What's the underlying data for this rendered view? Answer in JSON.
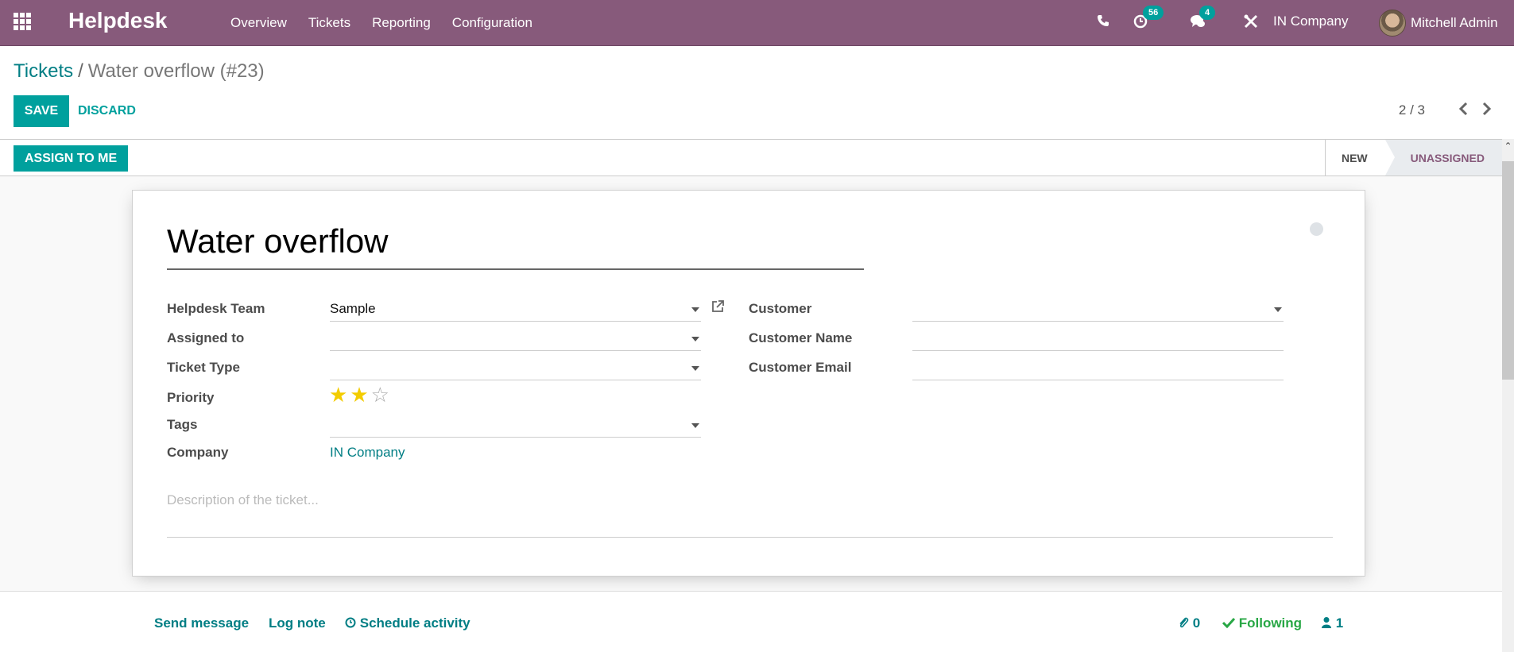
{
  "navbar": {
    "app_name": "Helpdesk",
    "menu": [
      "Overview",
      "Tickets",
      "Reporting",
      "Configuration"
    ],
    "systray": {
      "phone_icon": "phone-icon",
      "activity_badge": "56",
      "messages_badge": "4",
      "debug_icon": "tools-icon",
      "company": "IN Company",
      "user": "Mitchell Admin"
    },
    "bg_color": "#875a7b"
  },
  "breadcrumb": {
    "parent": "Tickets",
    "separator": "/",
    "current": "Water overflow (#23)"
  },
  "toolbar": {
    "save_label": "SAVE",
    "discard_label": "DISCARD",
    "pager": "2 / 3",
    "prev_icon": "‹",
    "next_icon": "›"
  },
  "statusbar": {
    "assign_label": "ASSIGN TO ME",
    "stages": [
      {
        "label": "NEW",
        "active": false
      },
      {
        "label": "UNASSIGNED",
        "active": true
      }
    ]
  },
  "form": {
    "title": "Water overflow",
    "left_fields": {
      "helpdesk_team": {
        "label": "Helpdesk Team",
        "value": "Sample"
      },
      "assigned_to": {
        "label": "Assigned to",
        "value": ""
      },
      "ticket_type": {
        "label": "Ticket Type",
        "value": ""
      },
      "priority": {
        "label": "Priority",
        "value": 2,
        "max": 3
      },
      "tags": {
        "label": "Tags",
        "value": ""
      },
      "company": {
        "label": "Company",
        "value": "IN Company"
      }
    },
    "right_fields": {
      "customer": {
        "label": "Customer",
        "value": ""
      },
      "customer_name": {
        "label": "Customer Name",
        "value": ""
      },
      "customer_email": {
        "label": "Customer Email",
        "value": ""
      }
    },
    "description_placeholder": "Description of the ticket..."
  },
  "chatter": {
    "send_message": "Send message",
    "log_note": "Log note",
    "schedule_activity": "Schedule activity",
    "attachments_count": "0",
    "following_label": "Following",
    "followers_count": "1"
  },
  "colors": {
    "accent": "#00a09d",
    "link": "#017e84",
    "following": "#28a745",
    "star_on": "#f3cc00"
  }
}
